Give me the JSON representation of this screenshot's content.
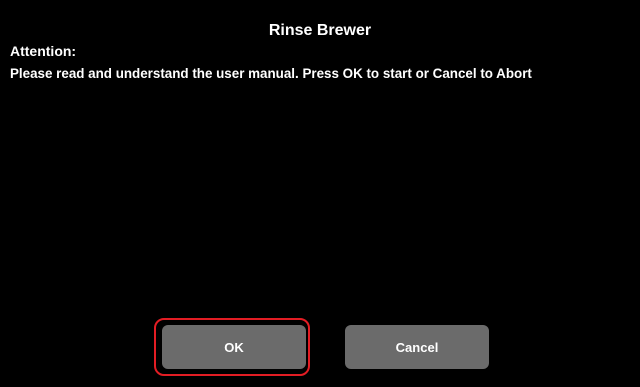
{
  "dialog": {
    "title": "Rinse Brewer",
    "attention_label": "Attention:",
    "message": "Please read and understand the user manual.  Press OK to start or Cancel to Abort"
  },
  "buttons": {
    "ok_label": "OK",
    "cancel_label": "Cancel"
  },
  "colors": {
    "background": "#000000",
    "button_fill": "#6b6b6b",
    "highlight_border": "#e31d24",
    "text": "#ffffff"
  }
}
